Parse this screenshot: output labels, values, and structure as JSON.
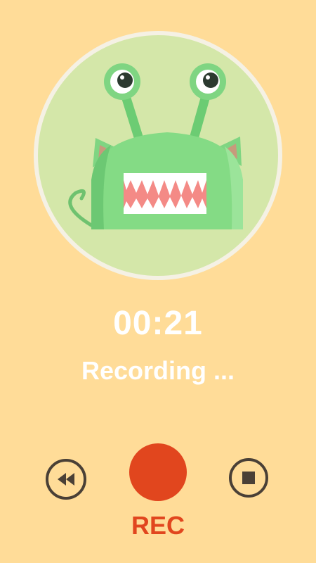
{
  "recorder": {
    "timer": "00:21",
    "status": "Recording ...",
    "rec_label": "REC"
  },
  "controls": {
    "rewind_icon": "rewind-icon",
    "record_icon": "record-icon",
    "stop_icon": "stop-icon"
  },
  "avatar": {
    "icon": "green-monster-icon"
  },
  "colors": {
    "background": "#ffdc98",
    "avatar_bg": "#d4e7a9",
    "monster_green": "#7fd582",
    "record_red": "#e1461e",
    "icon_dark": "#4a4036",
    "text_white": "#ffffff"
  }
}
